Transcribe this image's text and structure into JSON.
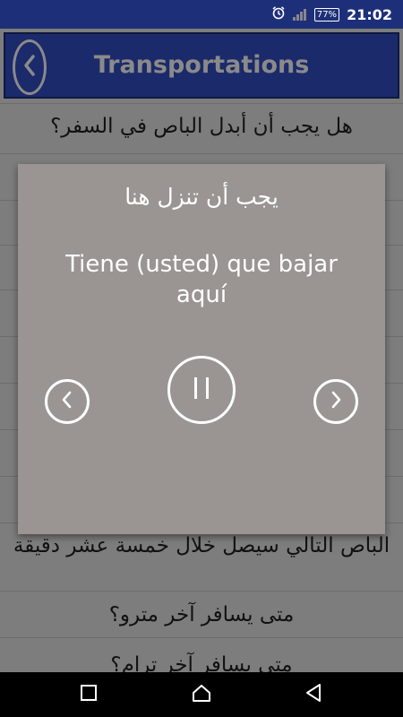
{
  "status_bar": {
    "battery": "77%",
    "time": "21:02",
    "icons": [
      "alarm-icon",
      "signal-icon",
      "battery-icon"
    ]
  },
  "header": {
    "title": "Transportations",
    "back_icon": "chevron-left-icon"
  },
  "list": {
    "items": [
      "هل يجب أن أبدل الباص في السفر؟",
      "الباص التالي سيصل خلال خمسة عشر دقيقة",
      "متى يسافر آخر مترو؟",
      "متى يسافر آخر ترام؟"
    ]
  },
  "dialog": {
    "arabic": "يجب أن تنزل هنا",
    "spanish": "Tiene (usted) que bajar aquí",
    "prev_icon": "chevron-left-icon",
    "pause_icon": "pause-icon",
    "next_icon": "chevron-right-icon"
  },
  "nav_bar": {
    "icons": [
      "recents-icon",
      "home-icon",
      "back-icon"
    ]
  }
}
